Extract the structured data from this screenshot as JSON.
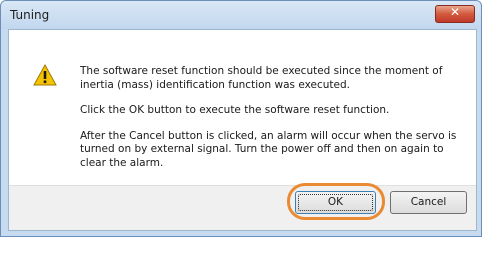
{
  "window": {
    "title": "Tuning",
    "close_icon": "close-icon",
    "close_glyph": "✕"
  },
  "message": {
    "icon": "warning-icon",
    "paragraphs": [
      "The software reset function should be executed since the moment of inertia (mass) identification function was executed.",
      "Click the OK button to execute the software reset function.",
      "After the Cancel button is clicked, an alarm will occur when the servo is turned on by external signal. Turn the power off and then on again to clear the alarm."
    ]
  },
  "buttons": {
    "ok": "OK",
    "cancel": "Cancel"
  },
  "colors": {
    "highlight": "#ea8a32",
    "warning": "#f5c400",
    "close": "#c0392b"
  }
}
